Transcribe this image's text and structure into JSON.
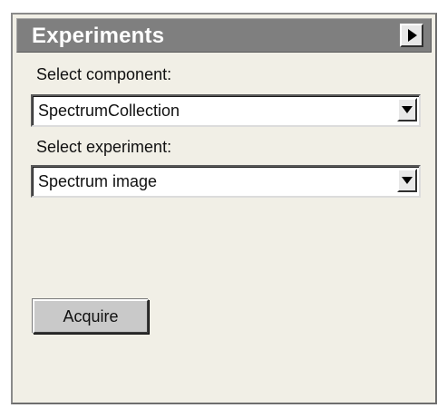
{
  "panel": {
    "title": "Experiments",
    "collapse_icon": "triangle-right-icon"
  },
  "component": {
    "label": "Select component:",
    "selected": "SpectrumCollection",
    "dropdown_icon": "chevron-down-icon"
  },
  "experiment": {
    "label": "Select experiment:",
    "selected": "Spectrum image",
    "dropdown_icon": "chevron-down-icon"
  },
  "actions": {
    "acquire_label": "Acquire"
  },
  "colors": {
    "header_bg": "#7f7f7f",
    "panel_bg": "#f1efe6",
    "button_bg": "#c9c9c9"
  }
}
